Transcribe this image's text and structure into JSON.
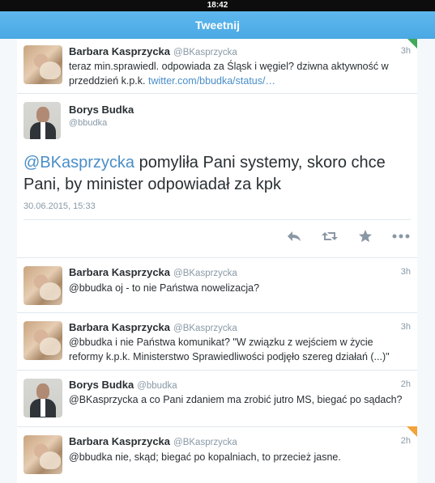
{
  "status_bar": {
    "time": "18:42"
  },
  "header": {
    "title": "Tweetnij"
  },
  "colors": {
    "accent": "#55acee",
    "link": "#4a8ec7",
    "corner_green": "#41a95a",
    "corner_orange": "#f2a33a"
  },
  "tweets": [
    {
      "name": "Barbara Kasprzycka",
      "handle": "@BKasprzycka",
      "time": "3h",
      "text": "teraz min.sprawiedl. odpowiada za Śląsk i węgiel? dziwna aktywność w przeddzień k.p.k. ",
      "link": "twitter.com/bbudka/status/…"
    }
  ],
  "detail": {
    "name": "Borys Budka",
    "handle": "@bbudka",
    "mention": "@BKasprzycka",
    "text": " pomyliła Pani systemy, skoro chce Pani, by minister odpowiadał za kpk",
    "date": "30.06.2015, 15:33",
    "actions": [
      "reply-icon",
      "retweet-icon",
      "favorite-icon",
      "more-icon"
    ]
  },
  "replies": [
    {
      "name": "Barbara Kasprzycka",
      "handle": "@BKasprzycka",
      "time": "3h",
      "text": "@bbudka oj - to nie Państwa nowelizacja?"
    },
    {
      "name": "Barbara Kasprzycka",
      "handle": "@BKasprzycka",
      "time": "3h",
      "text": "@bbudka i nie Państwa komunikat? \"W związku z wejściem w życie reformy k.p.k. Ministerstwo Sprawiedliwości podjęło szereg działań (...)\""
    },
    {
      "name": "Borys Budka",
      "handle": "@bbudka",
      "time": "2h",
      "text": "@BKasprzycka a co Pani zdaniem ma zrobić jutro MS, biegać po sądach?"
    },
    {
      "name": "Barbara Kasprzycka",
      "handle": "@BKasprzycka",
      "time": "2h",
      "text": "@bbudka nie, skąd; biegać po kopalniach, to przecież jasne."
    }
  ]
}
